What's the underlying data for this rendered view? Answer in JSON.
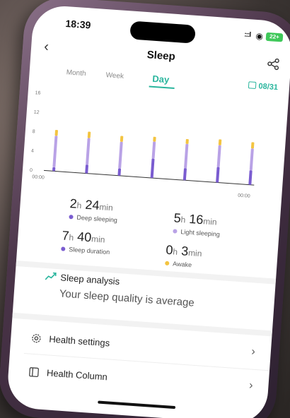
{
  "status_bar": {
    "time": "18:39",
    "signal": ":::l",
    "battery": "22+"
  },
  "header": {
    "title": "Sleep",
    "back_icon": "chevron-left-icon",
    "share_icon": "share-icon"
  },
  "tabs": [
    {
      "label": "Month",
      "active": false
    },
    {
      "label": "Week",
      "active": false
    },
    {
      "label": "Day",
      "active": true
    }
  ],
  "date_picker": {
    "label": "08/31",
    "icon": "calendar-icon"
  },
  "chart_data": {
    "type": "bar",
    "ylim": [
      0,
      16
    ],
    "yticks": [
      "16",
      "12",
      "8",
      "4",
      "0"
    ],
    "x_start_label": "00:00",
    "x_end_label": "00:00",
    "bars": [
      {
        "light": 6.5,
        "deep": 0.8,
        "awake": 1.2
      },
      {
        "light": 5.5,
        "deep": 1.8,
        "awake": 1.3
      },
      {
        "light": 5.5,
        "deep": 1.5,
        "awake": 1.2
      },
      {
        "light": 3.5,
        "deep": 4.0,
        "awake": 1.0
      },
      {
        "light": 5.0,
        "deep": 2.5,
        "awake": 1.0
      },
      {
        "light": 4.5,
        "deep": 3.2,
        "awake": 1.2
      },
      {
        "light": 4.5,
        "deep": 3.0,
        "awake": 1.3
      }
    ],
    "colors": {
      "light": "#b9a2e6",
      "deep": "#7a5cd0",
      "awake": "#f3c441"
    }
  },
  "stats": {
    "deep": {
      "hours": "2",
      "h_unit": "h",
      "minutes": "24",
      "m_unit": "min",
      "label": "Deep sleeping",
      "color": "#7a5cd0"
    },
    "light": {
      "hours": "5",
      "h_unit": "h",
      "minutes": "16",
      "m_unit": "min",
      "label": "Light sleeping",
      "color": "#b9a2e6"
    },
    "duration": {
      "hours": "7",
      "h_unit": "h",
      "minutes": "40",
      "m_unit": "min",
      "label": "Sleep duration",
      "color": "#7a5cd0"
    },
    "awake": {
      "hours": "0",
      "h_unit": "h",
      "minutes": "3",
      "m_unit": "min",
      "label": "Awake",
      "color": "#f3c441"
    }
  },
  "analysis": {
    "title": "Sleep analysis",
    "text": "Your sleep quality is average",
    "icon": "trend-chart-icon"
  },
  "menu": [
    {
      "label": "Health settings",
      "icon": "gear-icon"
    },
    {
      "label": "Health Column",
      "icon": "book-icon"
    }
  ]
}
